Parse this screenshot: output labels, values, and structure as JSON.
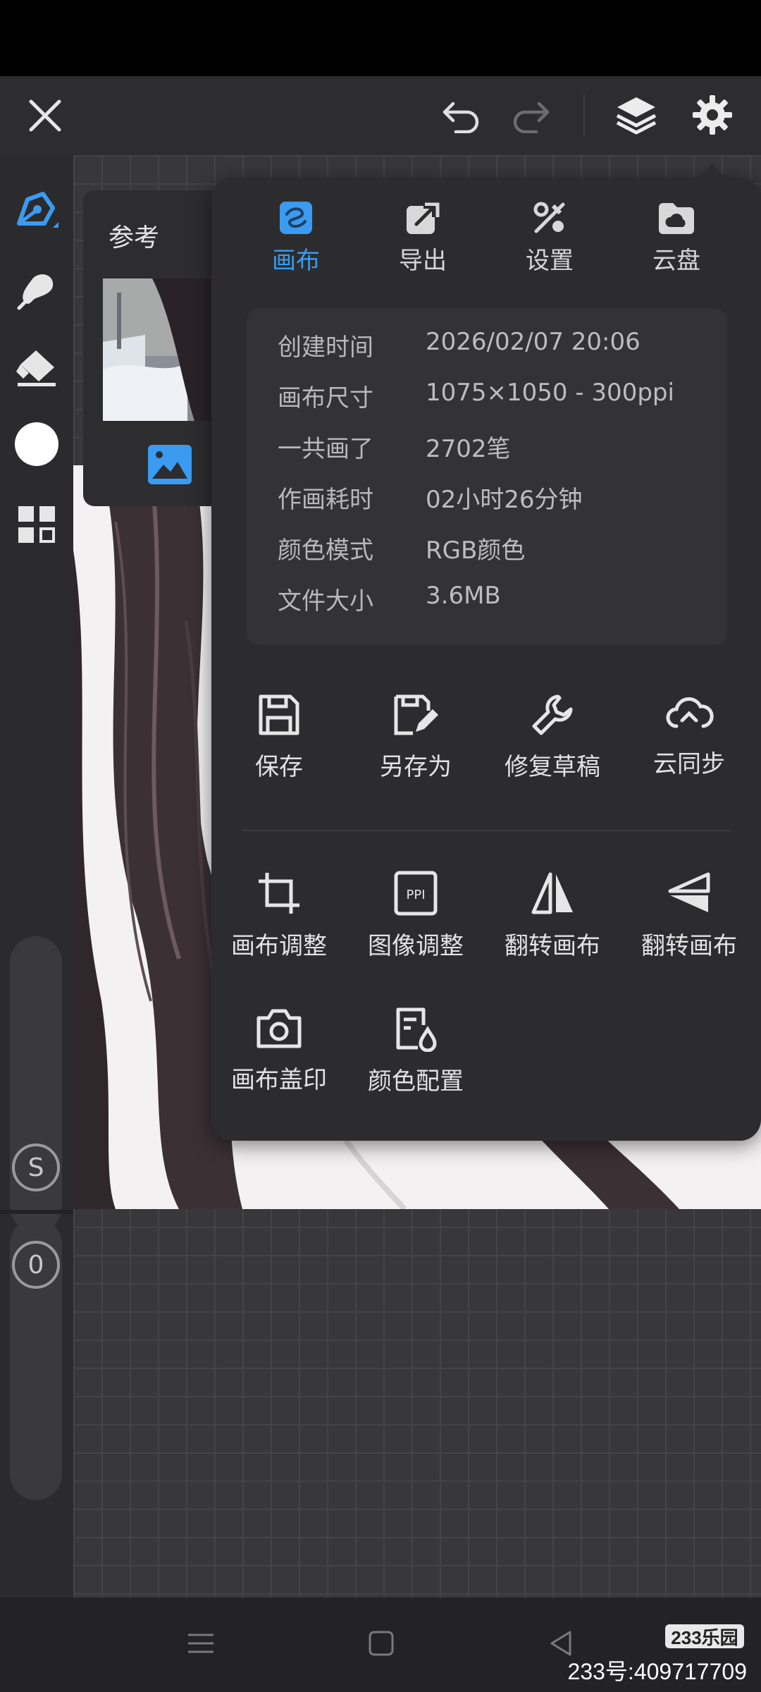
{
  "reference": {
    "title": "参考"
  },
  "menu": {
    "tabs": [
      {
        "label": "画布",
        "icon": "canvas-icon",
        "active": true
      },
      {
        "label": "导出",
        "icon": "export-icon",
        "active": false
      },
      {
        "label": "设置",
        "icon": "settings-tools-icon",
        "active": false
      },
      {
        "label": "云盘",
        "icon": "cloud-drive-icon",
        "active": false
      }
    ],
    "info": [
      {
        "key": "创建时间",
        "value": "2026/02/07 20:06"
      },
      {
        "key": "画布尺寸",
        "value": "1075×1050 - 300ppi"
      },
      {
        "key": "一共画了",
        "value": "2702笔"
      },
      {
        "key": "作画耗时",
        "value": "02小时26分钟"
      },
      {
        "key": "颜色模式",
        "value": "RGB颜色"
      },
      {
        "key": "文件大小",
        "value": "3.6MB"
      }
    ],
    "actions_row1": [
      {
        "label": "保存",
        "icon": "save-icon"
      },
      {
        "label": "另存为",
        "icon": "save-as-icon"
      },
      {
        "label": "修复草稿",
        "icon": "repair-icon"
      },
      {
        "label": "云同步",
        "icon": "cloud-sync-icon"
      }
    ],
    "actions_row2": [
      {
        "label": "画布调整",
        "icon": "crop-icon"
      },
      {
        "label": "图像调整",
        "icon": "ppi-icon"
      },
      {
        "label": "翻转画布",
        "icon": "flip-horizontal-icon"
      },
      {
        "label": "翻转画布",
        "icon": "flip-vertical-icon"
      }
    ],
    "actions_row3": [
      {
        "label": "画布盖印",
        "icon": "camera-icon"
      },
      {
        "label": "颜色配置",
        "icon": "color-config-icon"
      }
    ]
  },
  "toolbar": {
    "size_badge": "S",
    "opacity_badge": "0"
  },
  "colors": {
    "accent": "#3a9bf0",
    "panel": "#2c2c2e",
    "background": "#2a2a2c"
  },
  "watermark": {
    "logo": "233乐园",
    "text": "233号:409717709"
  }
}
